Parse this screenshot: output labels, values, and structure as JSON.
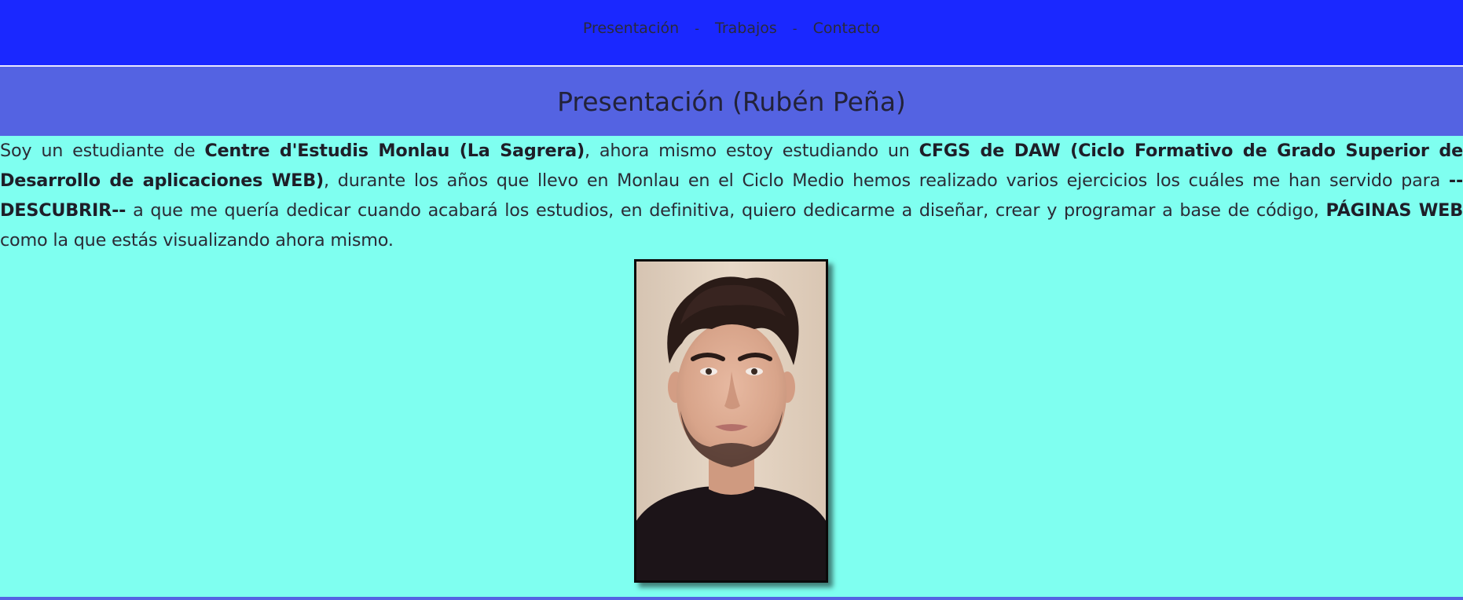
{
  "nav": {
    "items": [
      "Presentación",
      "Trabajos",
      "Contacto"
    ],
    "separator": "-"
  },
  "header": {
    "title": "Presentación (Rubén Peña)"
  },
  "intro": {
    "segments": [
      "Soy un estudiante de ",
      "Centre d'Estudis Monlau (La Sagrera)",
      ", ahora mismo estoy estudiando un ",
      "CFGS de DAW (Ciclo Formativo de Grado Superior de Desarrollo de aplicaciones WEB)",
      ", durante los años que llevo en Monlau en el Ciclo Medio hemos realizado varios ejercicios los cuáles me han servido para ",
      "--DESCUBRIR--",
      " a que me quería dedicar cuando acabará los estudios, en definitiva, quiero dedicarme a diseñar, crear y programar a base de código, ",
      "PÁGINAS WEB",
      " como la que estás visualizando ahora mismo."
    ]
  },
  "colors": {
    "nav_bg": "#1a28ff",
    "title_bg": "#5463e2",
    "page_bg": "#7ffff0"
  },
  "photo": {
    "icon": "portrait-photo"
  }
}
